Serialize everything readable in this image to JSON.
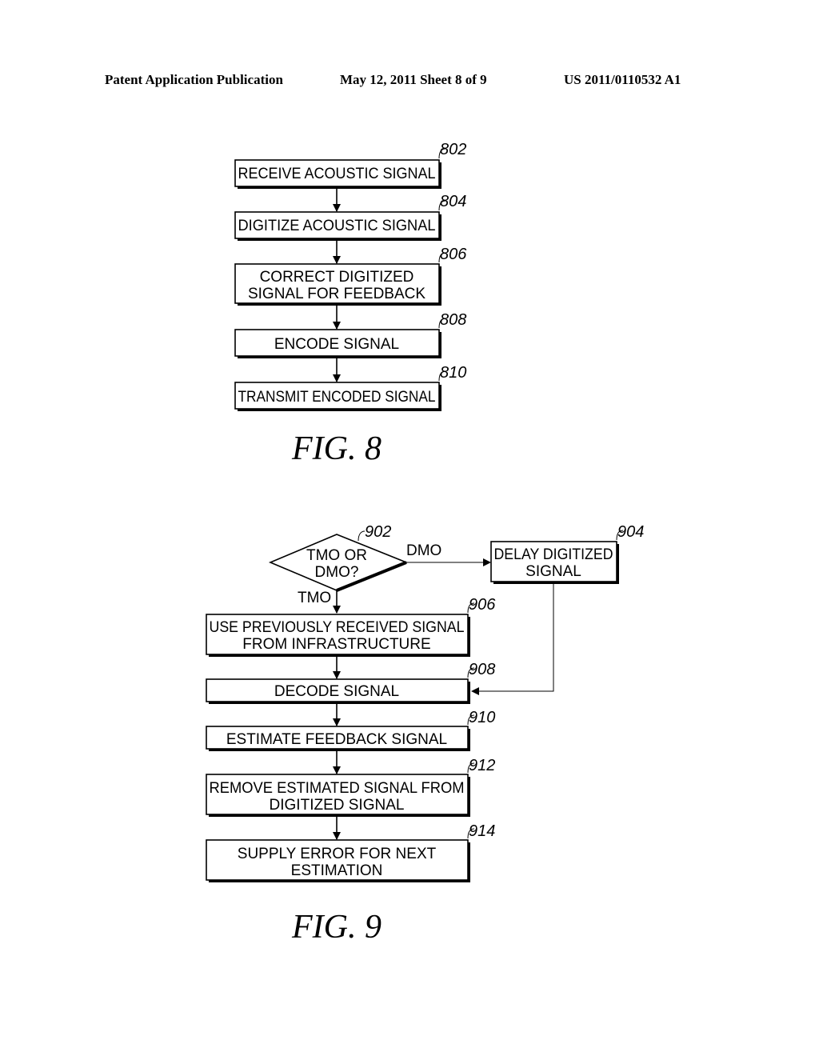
{
  "header": {
    "publication": "Patent Application Publication",
    "date_sheet": "May 12, 2011  Sheet 8 of 9",
    "number": "US 2011/0110532 A1"
  },
  "fig8": {
    "caption": "FIG. 8",
    "steps": [
      {
        "ref": "802",
        "lines": [
          "RECEIVE ACOUSTIC SIGNAL"
        ]
      },
      {
        "ref": "804",
        "lines": [
          "DIGITIZE ACOUSTIC SIGNAL"
        ]
      },
      {
        "ref": "806",
        "lines": [
          "CORRECT DIGITIZED",
          "SIGNAL FOR FEEDBACK"
        ]
      },
      {
        "ref": "808",
        "lines": [
          "ENCODE SIGNAL"
        ]
      },
      {
        "ref": "810",
        "lines": [
          "TRANSMIT ENCODED SIGNAL"
        ]
      }
    ]
  },
  "fig9": {
    "caption": "FIG. 9",
    "decision": {
      "ref": "902",
      "lines": [
        "TMO OR",
        "DMO?"
      ],
      "branch_right": "DMO",
      "branch_down": "TMO"
    },
    "delay": {
      "ref": "904",
      "lines": [
        "DELAY DIGITIZED",
        "SIGNAL"
      ]
    },
    "steps": [
      {
        "ref": "906",
        "lines": [
          "USE PREVIOUSLY RECEIVED SIGNAL",
          "FROM INFRASTRUCTURE"
        ]
      },
      {
        "ref": "908",
        "lines": [
          "DECODE SIGNAL"
        ]
      },
      {
        "ref": "910",
        "lines": [
          "ESTIMATE FEEDBACK SIGNAL"
        ]
      },
      {
        "ref": "912",
        "lines": [
          "REMOVE ESTIMATED SIGNAL FROM",
          "DIGITIZED SIGNAL"
        ]
      },
      {
        "ref": "914",
        "lines": [
          "SUPPLY ERROR FOR NEXT",
          "ESTIMATION"
        ]
      }
    ]
  }
}
